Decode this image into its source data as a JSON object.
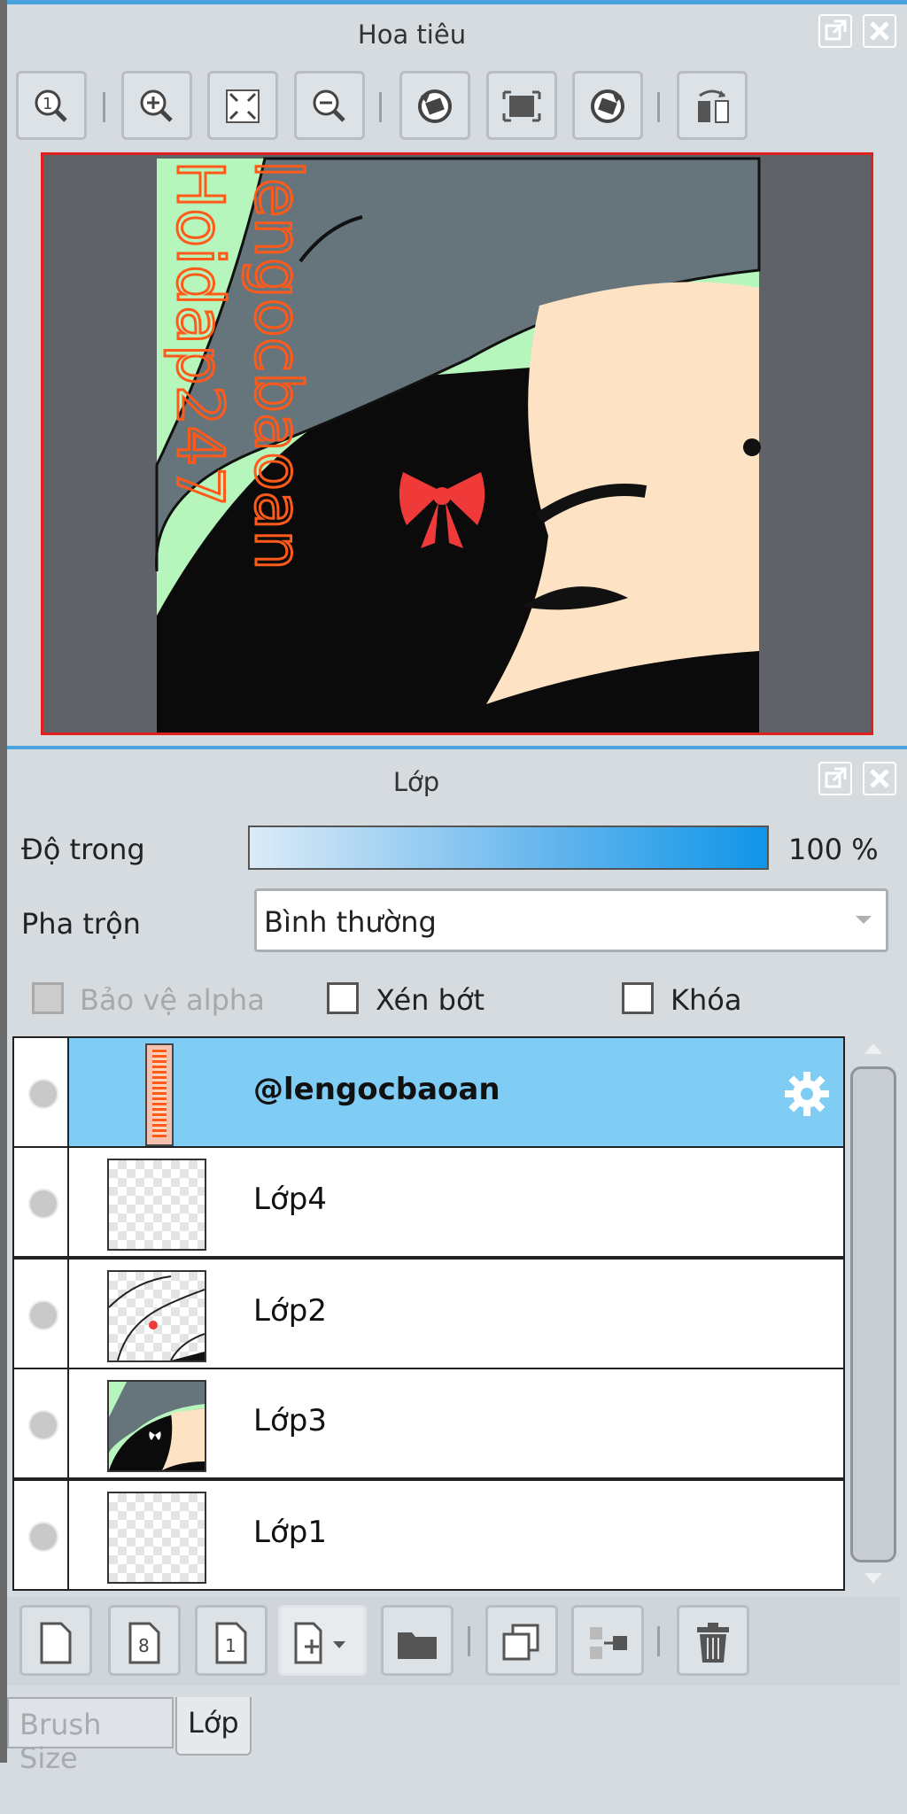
{
  "navigator": {
    "title": "Hoa tiêu",
    "watermark_line1": "lengocbaoan",
    "watermark_line2": "Hoidap247"
  },
  "layers_panel": {
    "title": "Lớp",
    "opacity_label": "Độ trong",
    "opacity_value": "100 %",
    "opacity_fraction": 1.0,
    "blend_label": "Pha trộn",
    "blend_value": "Bình thường",
    "protect_alpha_label": "Bảo vệ alpha",
    "clipping_label": "Xén bớt",
    "lock_label": "Khóa",
    "layers": [
      {
        "name": "@lengocbaoan",
        "selected": true
      },
      {
        "name": "Lớp4",
        "selected": false
      },
      {
        "name": "Lớp2",
        "selected": false
      },
      {
        "name": "Lớp3",
        "selected": false
      },
      {
        "name": "Lớp1",
        "selected": false
      }
    ]
  },
  "tabs": [
    {
      "label": "Brush Size",
      "active": false
    },
    {
      "label": "Lớp",
      "active": true
    }
  ],
  "colors": {
    "accent_blue": "#0f95e8",
    "selected_row": "#7fcdf4",
    "frame_red": "#e01f1f",
    "panel_bg": "#d6dbe0",
    "watermark_orange": "#ff5a1a",
    "bow_red": "#f03a3a",
    "hair_gray": "#66747b",
    "skin": "#fde3c3",
    "background_green": "#b6f5bb"
  },
  "icons": [
    "zoom-actual-icon",
    "zoom-in-icon",
    "fit-window-icon",
    "zoom-out-icon",
    "rotate-left-icon",
    "fit-screen-icon",
    "rotate-right-icon",
    "flip-horizontal-icon",
    "popout-icon",
    "close-icon",
    "gear-icon",
    "new-layer-icon",
    "new-8bit-layer-icon",
    "new-1bit-layer-icon",
    "add-layer-menu-icon",
    "folder-icon",
    "duplicate-layer-icon",
    "merge-layer-icon",
    "trash-icon"
  ]
}
